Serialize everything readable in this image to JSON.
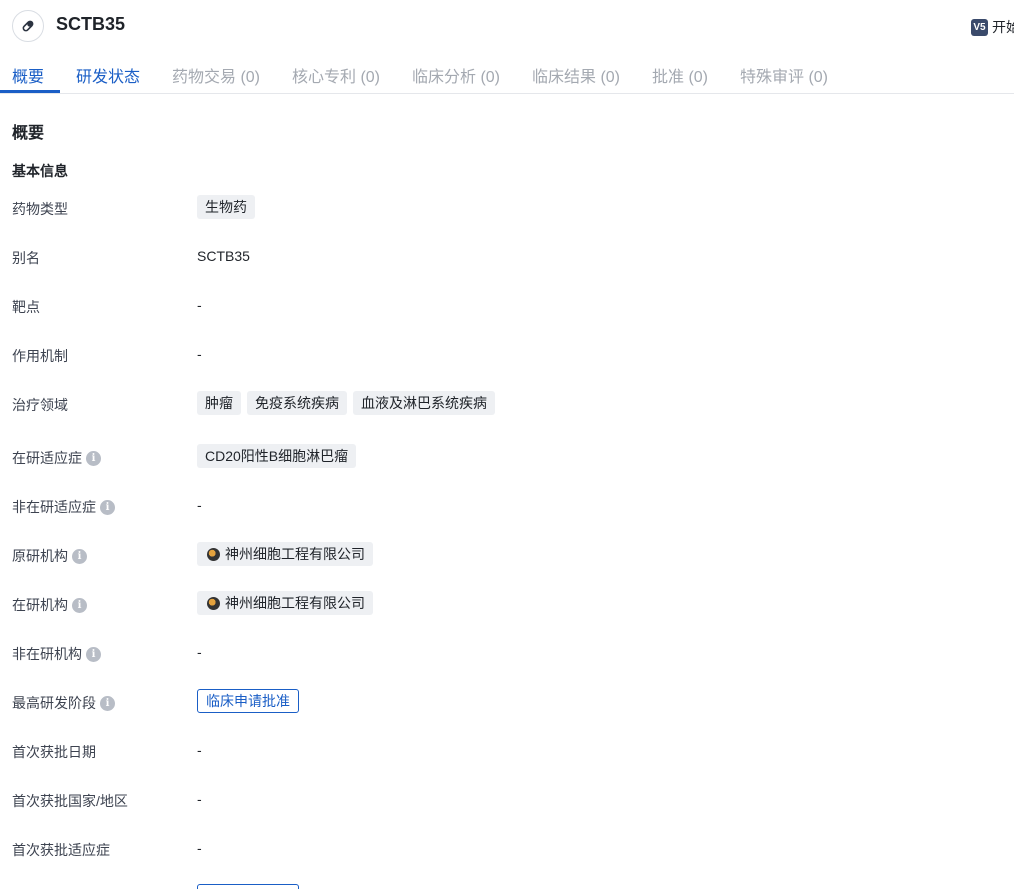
{
  "header": {
    "title": "SCTB35",
    "ai_badge": "V5",
    "ai_text": "开始"
  },
  "tabs": [
    {
      "label": "概要"
    },
    {
      "label": "研发状态"
    },
    {
      "label": "药物交易 (0)"
    },
    {
      "label": "核心专利 (0)"
    },
    {
      "label": "临床分析 (0)"
    },
    {
      "label": "临床结果 (0)"
    },
    {
      "label": "批准 (0)"
    },
    {
      "label": "特殊审评 (0)"
    }
  ],
  "overview": {
    "section_title": "概要",
    "basic_info_title": "基本信息",
    "rows": {
      "drug_type": {
        "label": "药物类型",
        "tags": [
          "生物药"
        ]
      },
      "alias": {
        "label": "别名",
        "value": "SCTB35"
      },
      "target": {
        "label": "靶点",
        "value": "-"
      },
      "mechanism": {
        "label": "作用机制",
        "value": "-"
      },
      "therapeutic_area": {
        "label": "治疗领域",
        "tags": [
          "肿瘤",
          "免疫系统疾病",
          "血液及淋巴系统疾病"
        ]
      },
      "active_indication": {
        "label": "在研适应症",
        "tags": [
          "CD20阳性B细胞淋巴瘤"
        ]
      },
      "inactive_indication": {
        "label": "非在研适应症",
        "value": "-"
      },
      "originator": {
        "label": "原研机构",
        "org": "神州细胞工程有限公司"
      },
      "active_org": {
        "label": "在研机构",
        "org": "神州细胞工程有限公司"
      },
      "inactive_org": {
        "label": "非在研机构",
        "value": "-"
      },
      "highest_phase": {
        "label": "最高研发阶段",
        "stage": "临床申请批准"
      },
      "first_approval_date": {
        "label": "首次获批日期",
        "value": "-"
      },
      "first_approval_country": {
        "label": "首次获批国家/地区",
        "value": "-"
      },
      "first_approval_indication": {
        "label": "首次获批适应症",
        "value": "-"
      }
    }
  },
  "icons": {
    "drug": "pill-icon",
    "info": "info-icon",
    "org": "org-logo-icon"
  },
  "colors": {
    "accent": "#1a5ec6",
    "tag_bg": "#eef0f3",
    "disabled_text": "#a4a9b1"
  }
}
